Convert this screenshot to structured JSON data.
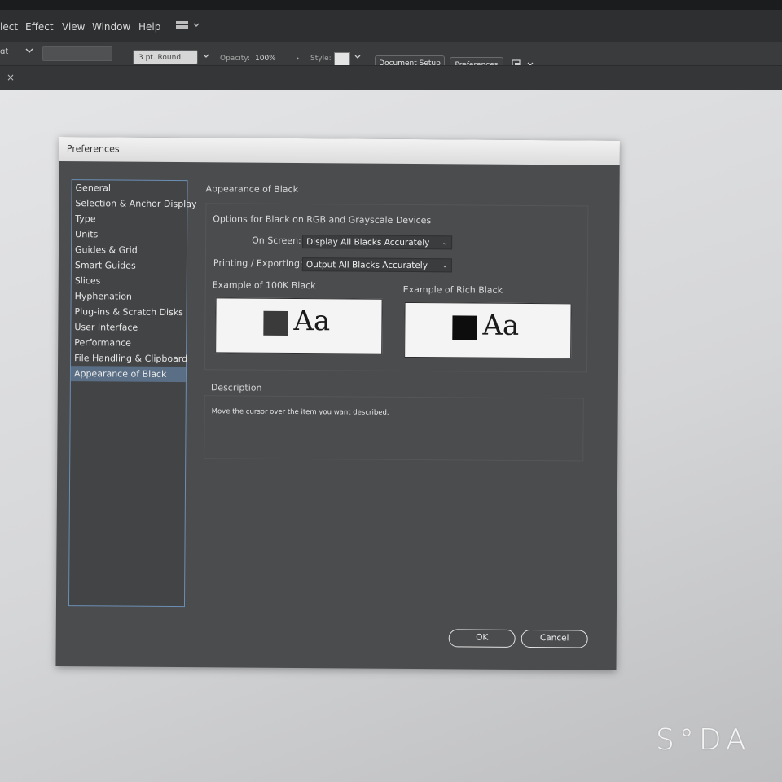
{
  "menubar": {
    "items": [
      "lect",
      "Effect",
      "View",
      "Window",
      "Help"
    ]
  },
  "toolbar": {
    "stroke_profile": "3 pt. Round",
    "opacity_label": "Opacity:",
    "opacity_value": "100%",
    "style_label": "Style:",
    "document_setup": "Document Setup",
    "preferences": "Preferences",
    "tab_close": "×"
  },
  "dialog": {
    "title": "Preferences",
    "nav_items": [
      {
        "label": "General",
        "selected": false
      },
      {
        "label": "Selection & Anchor Display",
        "selected": false
      },
      {
        "label": "Type",
        "selected": false
      },
      {
        "label": "Units",
        "selected": false
      },
      {
        "label": "Guides & Grid",
        "selected": false
      },
      {
        "label": "Smart Guides",
        "selected": false
      },
      {
        "label": "Slices",
        "selected": false
      },
      {
        "label": "Hyphenation",
        "selected": false
      },
      {
        "label": "Plug-ins & Scratch Disks",
        "selected": false
      },
      {
        "label": "User Interface",
        "selected": false
      },
      {
        "label": "Performance",
        "selected": false
      },
      {
        "label": "File Handling & Clipboard",
        "selected": false
      },
      {
        "label": "Appearance of Black",
        "selected": true
      }
    ],
    "panel_title": "Appearance of Black",
    "group_title": "Options for Black on RGB and Grayscale Devices",
    "on_screen_label": "On Screen:",
    "on_screen_value": "Display All Blacks Accurately",
    "printing_label": "Printing / Exporting:",
    "printing_value": "Output All Blacks Accurately",
    "example_100k_label": "Example of 100K Black",
    "example_rich_label": "Example of Rich Black",
    "example_glyph": "Aa",
    "swatch_100k_color": "#3a3a3a",
    "swatch_rich_color": "#0d0d0d",
    "description_title": "Description",
    "description_text": "Move the cursor over the item you want described.",
    "ok_label": "OK",
    "cancel_label": "Cancel"
  },
  "watermark": "S°DA"
}
